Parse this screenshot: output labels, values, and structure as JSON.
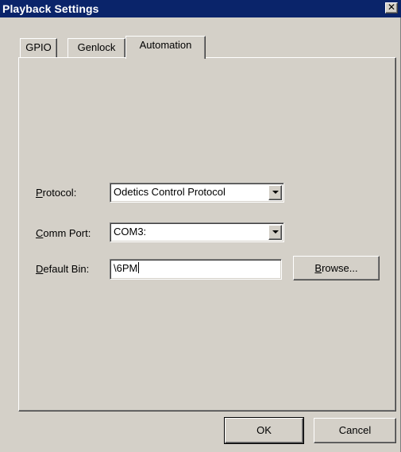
{
  "window": {
    "title": "Playback Settings",
    "close_glyph": "✕"
  },
  "tabs": [
    {
      "label": "GPIO",
      "active": false
    },
    {
      "label": "Genlock",
      "active": false
    },
    {
      "label": "Automation",
      "active": true
    }
  ],
  "automation": {
    "protocol": {
      "label_key": "P",
      "label_rest": "rotocol:",
      "value": "Odetics Control Protocol"
    },
    "comm_port": {
      "label_key": "C",
      "label_rest": "omm Port:",
      "value": "COM3:"
    },
    "default_bin": {
      "label_key": "D",
      "label_rest": "efault Bin:",
      "value": "\\6PM"
    },
    "browse_button": {
      "label_key": "B",
      "label_rest": "rowse..."
    }
  },
  "footer": {
    "ok_label": "OK",
    "cancel_label": "Cancel"
  }
}
